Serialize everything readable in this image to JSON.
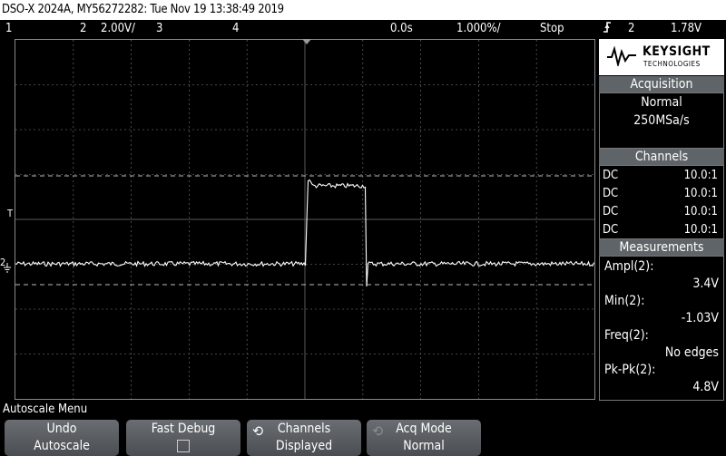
{
  "titlebar": {
    "text": "DSO-X 2024A, MY56272282: Tue Nov 19 13:38:49 2019"
  },
  "status": {
    "ch1": "1",
    "ch2": "2",
    "ch2_scale": "2.00V/",
    "ch3": "3",
    "ch4": "4",
    "time_delay": "0.0s",
    "time_scale": "1.000%/",
    "run_state": "Stop",
    "trigger_icon": "rising-edge-icon",
    "trigger_source": "2",
    "trigger_level": "1.78V"
  },
  "logo": {
    "brand": "KEYSIGHT",
    "sub": "TECHNOLOGIES"
  },
  "acquisition": {
    "header": "Acquisition",
    "mode": "Normal",
    "rate": "250MSa/s"
  },
  "channels": {
    "header": "Channels",
    "rows": [
      {
        "coupling": "DC",
        "probe": "10.0:1"
      },
      {
        "coupling": "DC",
        "probe": "10.0:1"
      },
      {
        "coupling": "DC",
        "probe": "10.0:1"
      },
      {
        "coupling": "DC",
        "probe": "10.0:1"
      }
    ]
  },
  "measurements": {
    "header": "Measurements",
    "items": [
      {
        "label": "Ampl(2):",
        "value": "3.4V"
      },
      {
        "label": "Min(2):",
        "value": "-1.03V"
      },
      {
        "label": "Freq(2):",
        "value": "No edges"
      },
      {
        "label": "Pk-Pk(2):",
        "value": "4.8V"
      }
    ]
  },
  "menu": {
    "title": "Autoscale Menu"
  },
  "softkeys": [
    {
      "line1": "Undo",
      "line2": "Autoscale"
    },
    {
      "line1": "Fast Debug",
      "line2": ""
    },
    {
      "line1": "Channels",
      "line2": "Displayed"
    },
    {
      "line1": "Acq Mode",
      "line2": "Normal"
    }
  ],
  "markers": {
    "trigger": "T",
    "ch2": "2"
  },
  "colors": {
    "trace": "#ffffff",
    "grid": "#5a5a5a",
    "panel_header": "#5f6468",
    "background": "#000000"
  }
}
